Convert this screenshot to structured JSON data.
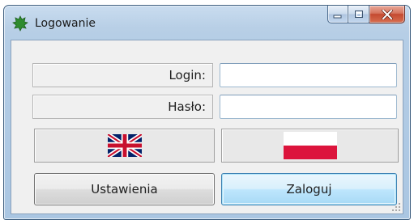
{
  "window": {
    "title": "Logowanie",
    "controls": {
      "minimize": "minimize-icon",
      "maximize": "maximize-icon",
      "close": "close-icon"
    }
  },
  "form": {
    "login_label": "Login:",
    "login_value": "",
    "password_label": "Hasło:",
    "password_value": ""
  },
  "languages": [
    {
      "icon": "uk-flag-icon"
    },
    {
      "icon": "poland-flag-icon"
    }
  ],
  "buttons": {
    "settings_label": "Ustawienia",
    "login_label": "Zaloguj"
  },
  "colors": {
    "title_bar": "#b8cfe6",
    "close_button": "#c44a30",
    "client_bg": "#f0f0f0",
    "default_button": "#bee6fd"
  }
}
